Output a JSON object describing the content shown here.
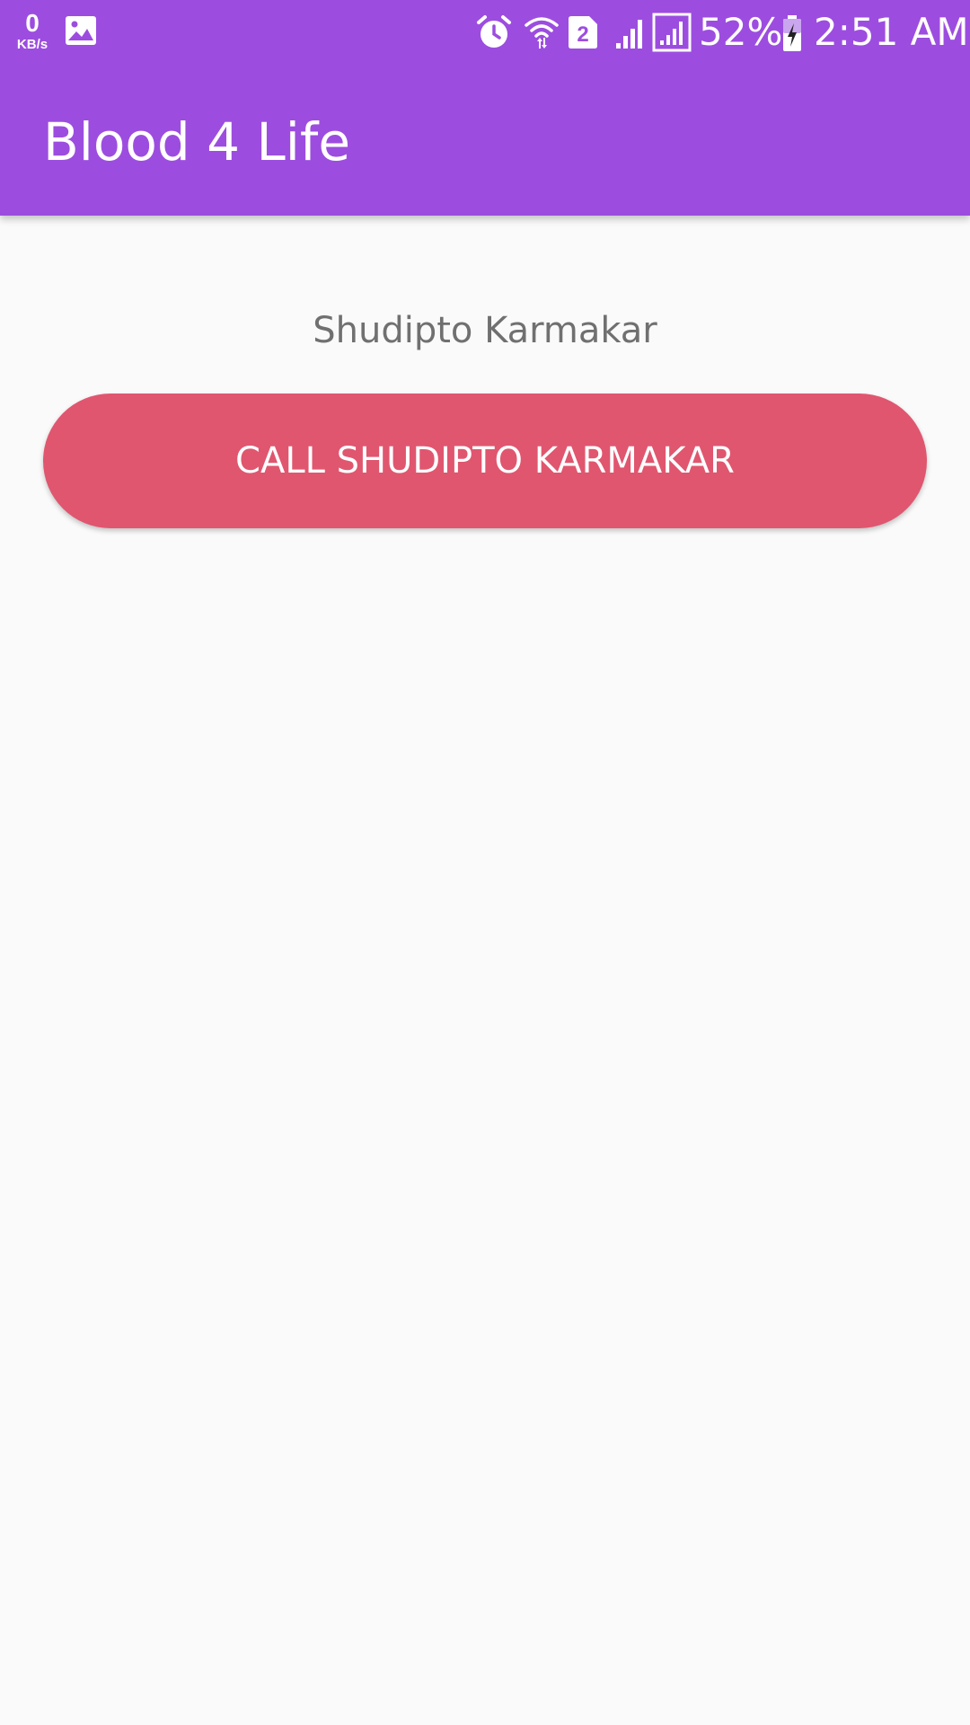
{
  "status_bar": {
    "net_speed_value": "0",
    "net_speed_unit": "KB/s",
    "icons": [
      "image-icon",
      "alarm-icon",
      "wifi-icon",
      "sim-2-icon",
      "signal-icon",
      "signal-icon",
      "battery-charging-icon"
    ],
    "battery_percent": "52%",
    "time": "2:51 AM"
  },
  "header": {
    "title": "Blood 4 Life"
  },
  "main": {
    "donor_name": "Shudipto Karmakar",
    "call_button_label": "CALL SHUDIPTO KARMAKAR"
  },
  "colors": {
    "app_bar": "#9c4ddf",
    "call_button": "#e0566f",
    "background": "#fafafa",
    "name_text": "#707070"
  }
}
